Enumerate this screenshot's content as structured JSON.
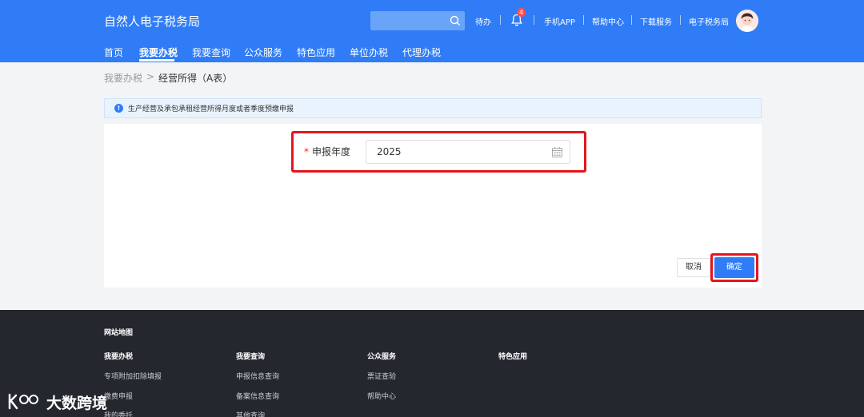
{
  "header": {
    "title": "自然人电子税务局",
    "search": {
      "placeholder": ""
    },
    "links": {
      "todo": "待办",
      "notification_count": "4",
      "mobile_app": "手机APP",
      "help_center": "帮助中心",
      "download": "下载服务",
      "tax_bureau": "电子税务局"
    }
  },
  "nav": {
    "items": [
      "首页",
      "我要办税",
      "我要查询",
      "公众服务",
      "特色应用",
      "单位办税",
      "代理办税"
    ],
    "active_index": 1
  },
  "breadcrumb": {
    "root": "我要办税",
    "separator": ">",
    "current": "经营所得（A表）"
  },
  "info": {
    "icon": "info-icon",
    "text": "生产经营及承包承租经营所得月度或者季度预缴申报"
  },
  "form": {
    "required_mark": "*",
    "year_label": "申报年度",
    "year_value": "2025",
    "calendar_icon": "calendar-icon"
  },
  "buttons": {
    "cancel": "取消",
    "confirm": "确定"
  },
  "footer": {
    "title": "网站地图",
    "columns": [
      {
        "title": "我要办税",
        "links": [
          "专项附加扣除填报",
          "缴费申报",
          "我的委托"
        ]
      },
      {
        "title": "我要查询",
        "links": [
          "申报信息查询",
          "备案信息查询",
          "其他查询"
        ]
      },
      {
        "title": "公众服务",
        "links": [
          "票证查验",
          "帮助中心"
        ]
      },
      {
        "title": "特色应用",
        "links": []
      }
    ]
  },
  "watermark": {
    "text": "大数跨境"
  },
  "colors": {
    "primary": "#2f7cf6",
    "highlight": "#e3161d",
    "footer_bg": "#24272e",
    "page_bg": "#f3f4f6"
  }
}
